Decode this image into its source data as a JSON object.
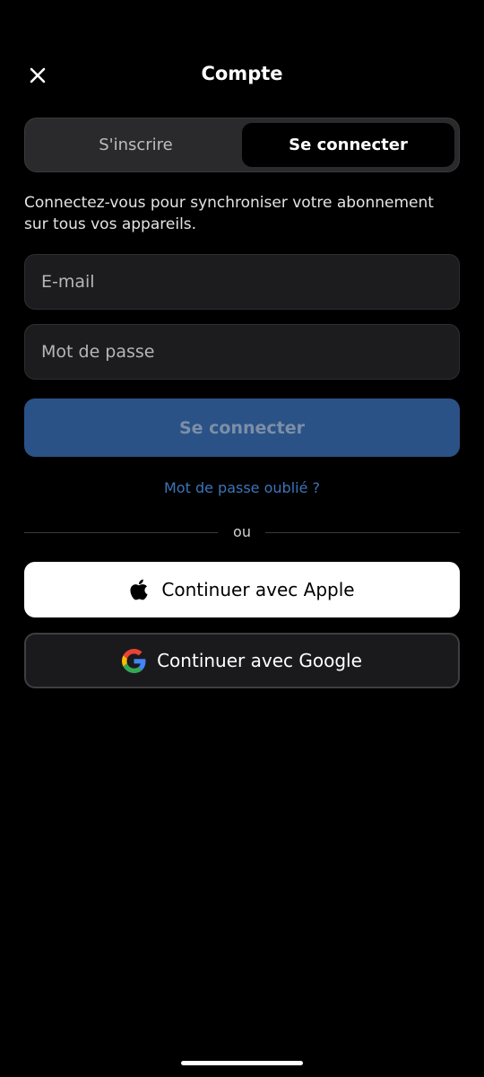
{
  "header": {
    "title": "Compte",
    "close_icon": "close-icon"
  },
  "tabs": {
    "signup_label": "S'inscrire",
    "signin_label": "Se connecter",
    "active": "signin"
  },
  "subtitle": "Connectez-vous pour synchroniser votre abonnement sur tous vos appareils.",
  "form": {
    "email": {
      "value": "",
      "placeholder": "E-mail"
    },
    "password": {
      "value": "",
      "placeholder": "Mot de passe"
    },
    "submit_label": "Se connecter",
    "forgot_label": "Mot de passe oublié ?"
  },
  "divider_label": "ou",
  "social": {
    "apple_label": "Continuer avec Apple",
    "apple_icon": "apple-icon",
    "google_label": "Continuer avec Google",
    "google_icon": "google-icon"
  },
  "colors": {
    "background": "#000000",
    "primary_button": "#2a5286",
    "link": "#3d74b9",
    "google_blue": "#4285F4",
    "google_red": "#EA4335",
    "google_yellow": "#FBBC05",
    "google_green": "#34A853"
  }
}
